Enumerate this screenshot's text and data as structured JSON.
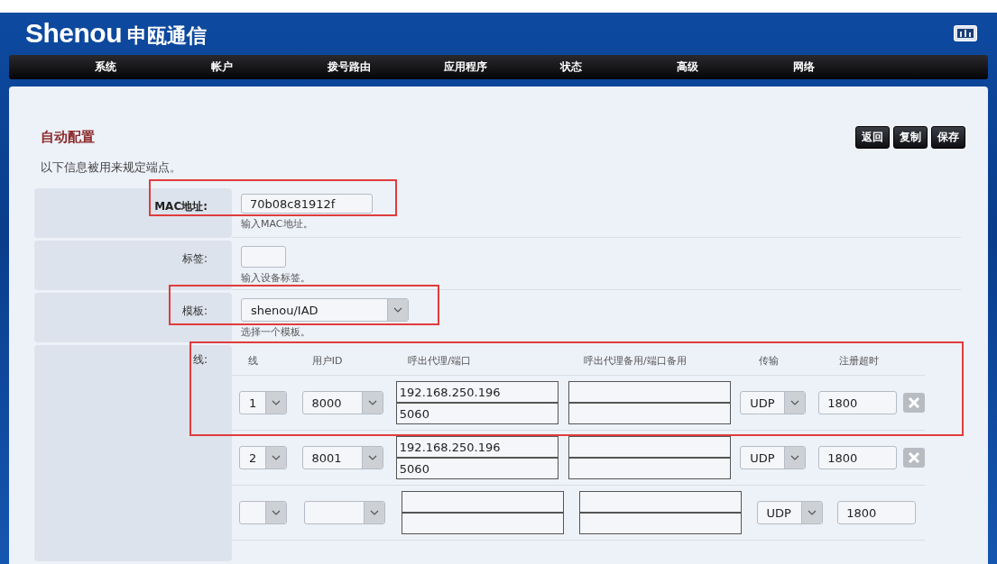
{
  "header": {
    "logo_text": "Shenou",
    "logo_cn": "申瓯通信"
  },
  "nav": [
    "系统",
    "帐户",
    "拨号路由",
    "应用程序",
    "状态",
    "高级",
    "网络"
  ],
  "page": {
    "title": "自动配置",
    "description": "以下信息被用来规定端点。",
    "buttons": [
      "返回",
      "复制",
      "保存"
    ]
  },
  "fields": [
    {
      "kind": "text",
      "label": "MAC地址:",
      "value": "70b08c81912f",
      "hint": "输入MAC地址。",
      "highlighted": true
    },
    {
      "kind": "short",
      "label": "标签:",
      "hint": "输入设备标签。",
      "highlighted": false
    },
    {
      "kind": "select",
      "label": "模板:",
      "value": "shenou/IAD",
      "hint": "选择一个模板。",
      "highlighted": true
    }
  ],
  "lines": {
    "label": "线:",
    "highlighted": true,
    "columns": [
      "线",
      "用户ID",
      "呼出代理/端口",
      "呼出代理备用/端口备用",
      "传输",
      "注册超时"
    ],
    "rows": [
      {
        "line": "1",
        "user_id": "8000",
        "proxy": "192.168.250.196",
        "port": "5060",
        "transport": "UDP",
        "timeout": "1800",
        "deletable": true
      },
      {
        "line": "2",
        "user_id": "8001",
        "proxy": "192.168.250.196",
        "port": "5060",
        "transport": "UDP",
        "timeout": "1800",
        "deletable": true
      },
      {
        "transport": "UDP",
        "timeout": "1800",
        "deletable": false
      }
    ]
  }
}
